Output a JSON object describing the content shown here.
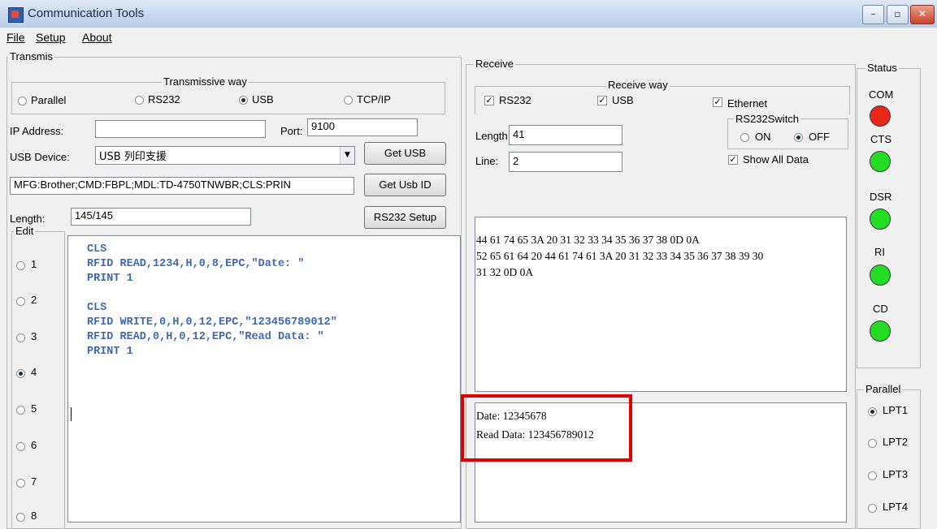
{
  "window": {
    "title": "Communication Tools",
    "minimize": "–",
    "maximize": "▫",
    "close": "✕"
  },
  "menu": [
    "File",
    "Setup",
    "About"
  ],
  "transmit": {
    "group_label": "Transmis",
    "way_label": "Transmissive way",
    "options": [
      "Parallel",
      "RS232",
      "USB",
      "TCP/IP"
    ],
    "selected": "USB",
    "ip_label": "IP Address:",
    "ip_value": "",
    "port_label": "Port:",
    "port_value": "9100",
    "usb_device_label": "USB Device:",
    "usb_device_value": "USB 列印支援",
    "get_usb": "Get USB",
    "usb_id_value": "MFG:Brother;CMD:FBPL;MDL:TD-4750TNWBR;CLS:PRIN",
    "get_usb_id": "Get Usb ID",
    "length_label": "Length:",
    "length_value": "145/145",
    "rs232_setup": "RS232 Setup"
  },
  "edit": {
    "group_label": "Edit",
    "slots": [
      "1",
      "2",
      "3",
      "4",
      "5",
      "6",
      "7",
      "8"
    ],
    "selected_slot": "4",
    "code_lines": [
      "CLS",
      "RFID READ,1234,H,0,8,EPC,\"Date: \"",
      "PRINT 1",
      "",
      "CLS",
      "RFID WRITE,0,H,0,12,EPC,\"123456789012\"",
      "RFID READ,0,H,0,12,EPC,\"Read Data: \"",
      "PRINT 1"
    ]
  },
  "receive": {
    "group_label": "Receive",
    "way_label": "Receive way",
    "rs232": "RS232",
    "usb": "USB",
    "ethernet": "Ethernet",
    "switch_label": "RS232Switch",
    "on": "ON",
    "off": "OFF",
    "switch_selected": "OFF",
    "length_label": "Length:",
    "length_value": "41",
    "line_label": "Line:",
    "line_value": "2",
    "show_all": "Show All Data",
    "hex_lines": [
      "44 61 74 65 3A 20 31 32 33 34 35 36 37 38 0D 0A",
      "52 65 61 64 20 44 61 74 61 3A 20 31 32 33 34 35 36 37 38 39 30",
      "31 32 0D 0A"
    ],
    "text_lines": [
      "Date: 12345678",
      "Read Data: 123456789012"
    ]
  },
  "status": {
    "group_label": "Status",
    "indicators": [
      "COM",
      "CTS",
      "DSR",
      "RI",
      "CD"
    ],
    "colors": {
      "COM": "#e8261a",
      "CTS": "#22dd22",
      "DSR": "#22dd22",
      "RI": "#22dd22",
      "CD": "#22dd22"
    }
  },
  "parallel": {
    "group_label": "Parallel",
    "ports": [
      "LPT1",
      "LPT2",
      "LPT3",
      "LPT4"
    ],
    "selected": "LPT1"
  },
  "highlight_color": "#e00000"
}
